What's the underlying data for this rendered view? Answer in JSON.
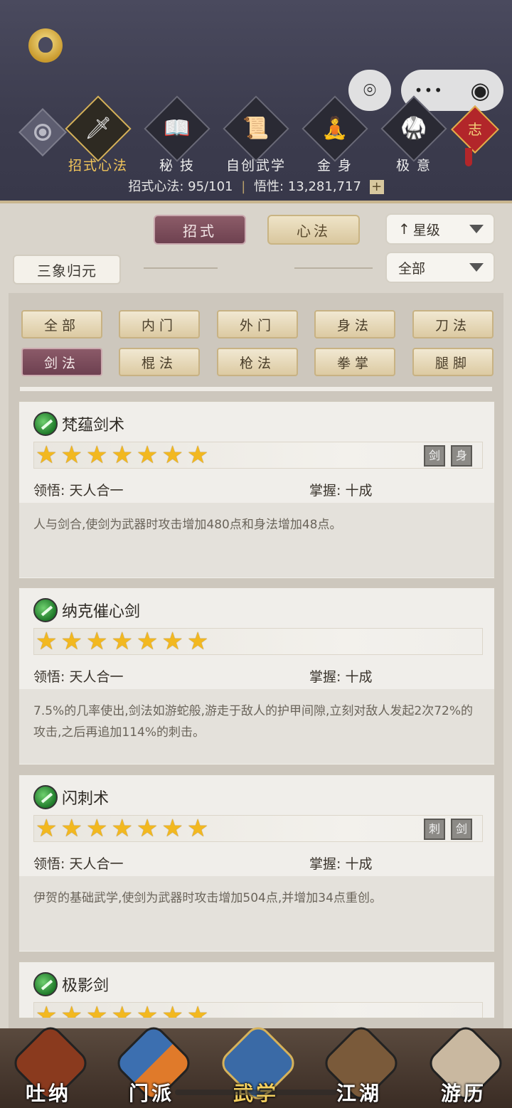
{
  "header": {
    "top_tabs": [
      {
        "label": "招式心法",
        "icon": "sword-icon",
        "glyph": "🗡",
        "active": true
      },
      {
        "label": "秘 技",
        "icon": "book-icon",
        "glyph": "📖",
        "active": false
      },
      {
        "label": "自创武学",
        "icon": "scroll-brush-icon",
        "glyph": "📜",
        "active": false
      },
      {
        "label": "金 身",
        "icon": "meditation-icon",
        "glyph": "🧘",
        "active": false
      },
      {
        "label": "极 意",
        "icon": "martial-pose-icon",
        "glyph": "🥋",
        "active": false
      }
    ],
    "charm_glyph": "志",
    "stats_label": "招式心法:",
    "stats_value": "95/101",
    "insight_label": "悟性:",
    "insight_value": "13,281,717",
    "plus_glyph": "+",
    "menu_glyph": "•••",
    "target_glyph": "◉"
  },
  "filters": {
    "tab_zhaoshi": "招式",
    "tab_xinfa": "心法",
    "sort_label": "星级",
    "sort_arrow": "↑",
    "scope_label": "三象归元",
    "range_label": "全部"
  },
  "categories": [
    "全部",
    "内门",
    "外门",
    "身法",
    "刀法",
    "剑法",
    "棍法",
    "枪法",
    "拳掌",
    "腿脚"
  ],
  "selected_category": "剑法",
  "skills": [
    {
      "name": "梵蕴剑术",
      "stars": "★★★★★★★",
      "insight_label": "领悟:",
      "insight": "天人合一",
      "mastery_label": "掌握:",
      "mastery": "十成",
      "desc": "人与剑合,使剑为武器时攻击增加480点和身法增加48点。",
      "icons": [
        "剑",
        "身"
      ]
    },
    {
      "name": "纳克催心剑",
      "stars": "★★★★★★★",
      "insight_label": "领悟:",
      "insight": "天人合一",
      "mastery_label": "掌握:",
      "mastery": "十成",
      "desc": "7.5%的几率使出,剑法如游蛇般,游走于敌人的护甲间隙,立刻对敌人发起2次72%的攻击,之后再追加114%的刺击。",
      "icons": []
    },
    {
      "name": "闪刺术",
      "stars": "★★★★★★★",
      "insight_label": "领悟:",
      "insight": "天人合一",
      "mastery_label": "掌握:",
      "mastery": "十成",
      "desc": "伊贺的基础武学,使剑为武器时攻击增加504点,并增加34点重创。",
      "icons": [
        "刺",
        "剑"
      ]
    },
    {
      "name": "极影剑",
      "stars": "★★★★★★★"
    }
  ],
  "bottom_nav": [
    {
      "label": "吐纳",
      "color": "#8a3a1e",
      "active": false
    },
    {
      "label": "门派",
      "color": "#3c6fb0",
      "active": false
    },
    {
      "label": "武学",
      "color": "#3a6aa6",
      "active": true
    },
    {
      "label": "江湖",
      "color": "#7a5a3a",
      "active": false
    },
    {
      "label": "游历",
      "color": "#c9b8a0",
      "active": false
    }
  ]
}
